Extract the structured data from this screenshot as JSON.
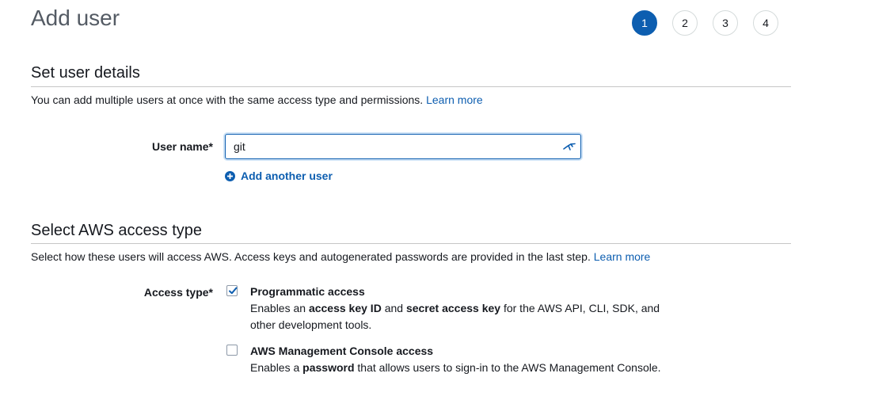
{
  "header": {
    "title": "Add user",
    "steps": [
      "1",
      "2",
      "3",
      "4"
    ],
    "active_step": "1"
  },
  "user_details": {
    "title": "Set user details",
    "description": "You can add multiple users at once with the same access type and permissions.",
    "learn_more": "Learn more",
    "user_name_label": "User name*",
    "user_name_value": "git",
    "add_another_user": "Add another user"
  },
  "access_type": {
    "title": "Select AWS access type",
    "description": "Select how these users will access AWS. Access keys and autogenerated passwords are provided in the last step.",
    "learn_more": "Learn more",
    "label": "Access type*",
    "options": [
      {
        "title": "Programmatic access",
        "checked": true,
        "desc_1": "Enables an ",
        "desc_2": "access key ID",
        "desc_3": " and ",
        "desc_4": "secret access key",
        "desc_5": " for the AWS API, CLI, SDK, and other development tools."
      },
      {
        "title": "AWS Management Console access",
        "checked": false,
        "desc_1": "Enables a ",
        "desc_2": "password",
        "desc_3": " that allows users to sign-in to the AWS Management Console."
      }
    ]
  },
  "colors": {
    "accent": "#0d5eb0",
    "text": "#16191f",
    "title_gray": "#545b64",
    "divider": "#c6c6c6"
  },
  "icons": {
    "input": "password-manager-icon",
    "add": "plus-circle-icon",
    "check": "checkmark-icon"
  }
}
